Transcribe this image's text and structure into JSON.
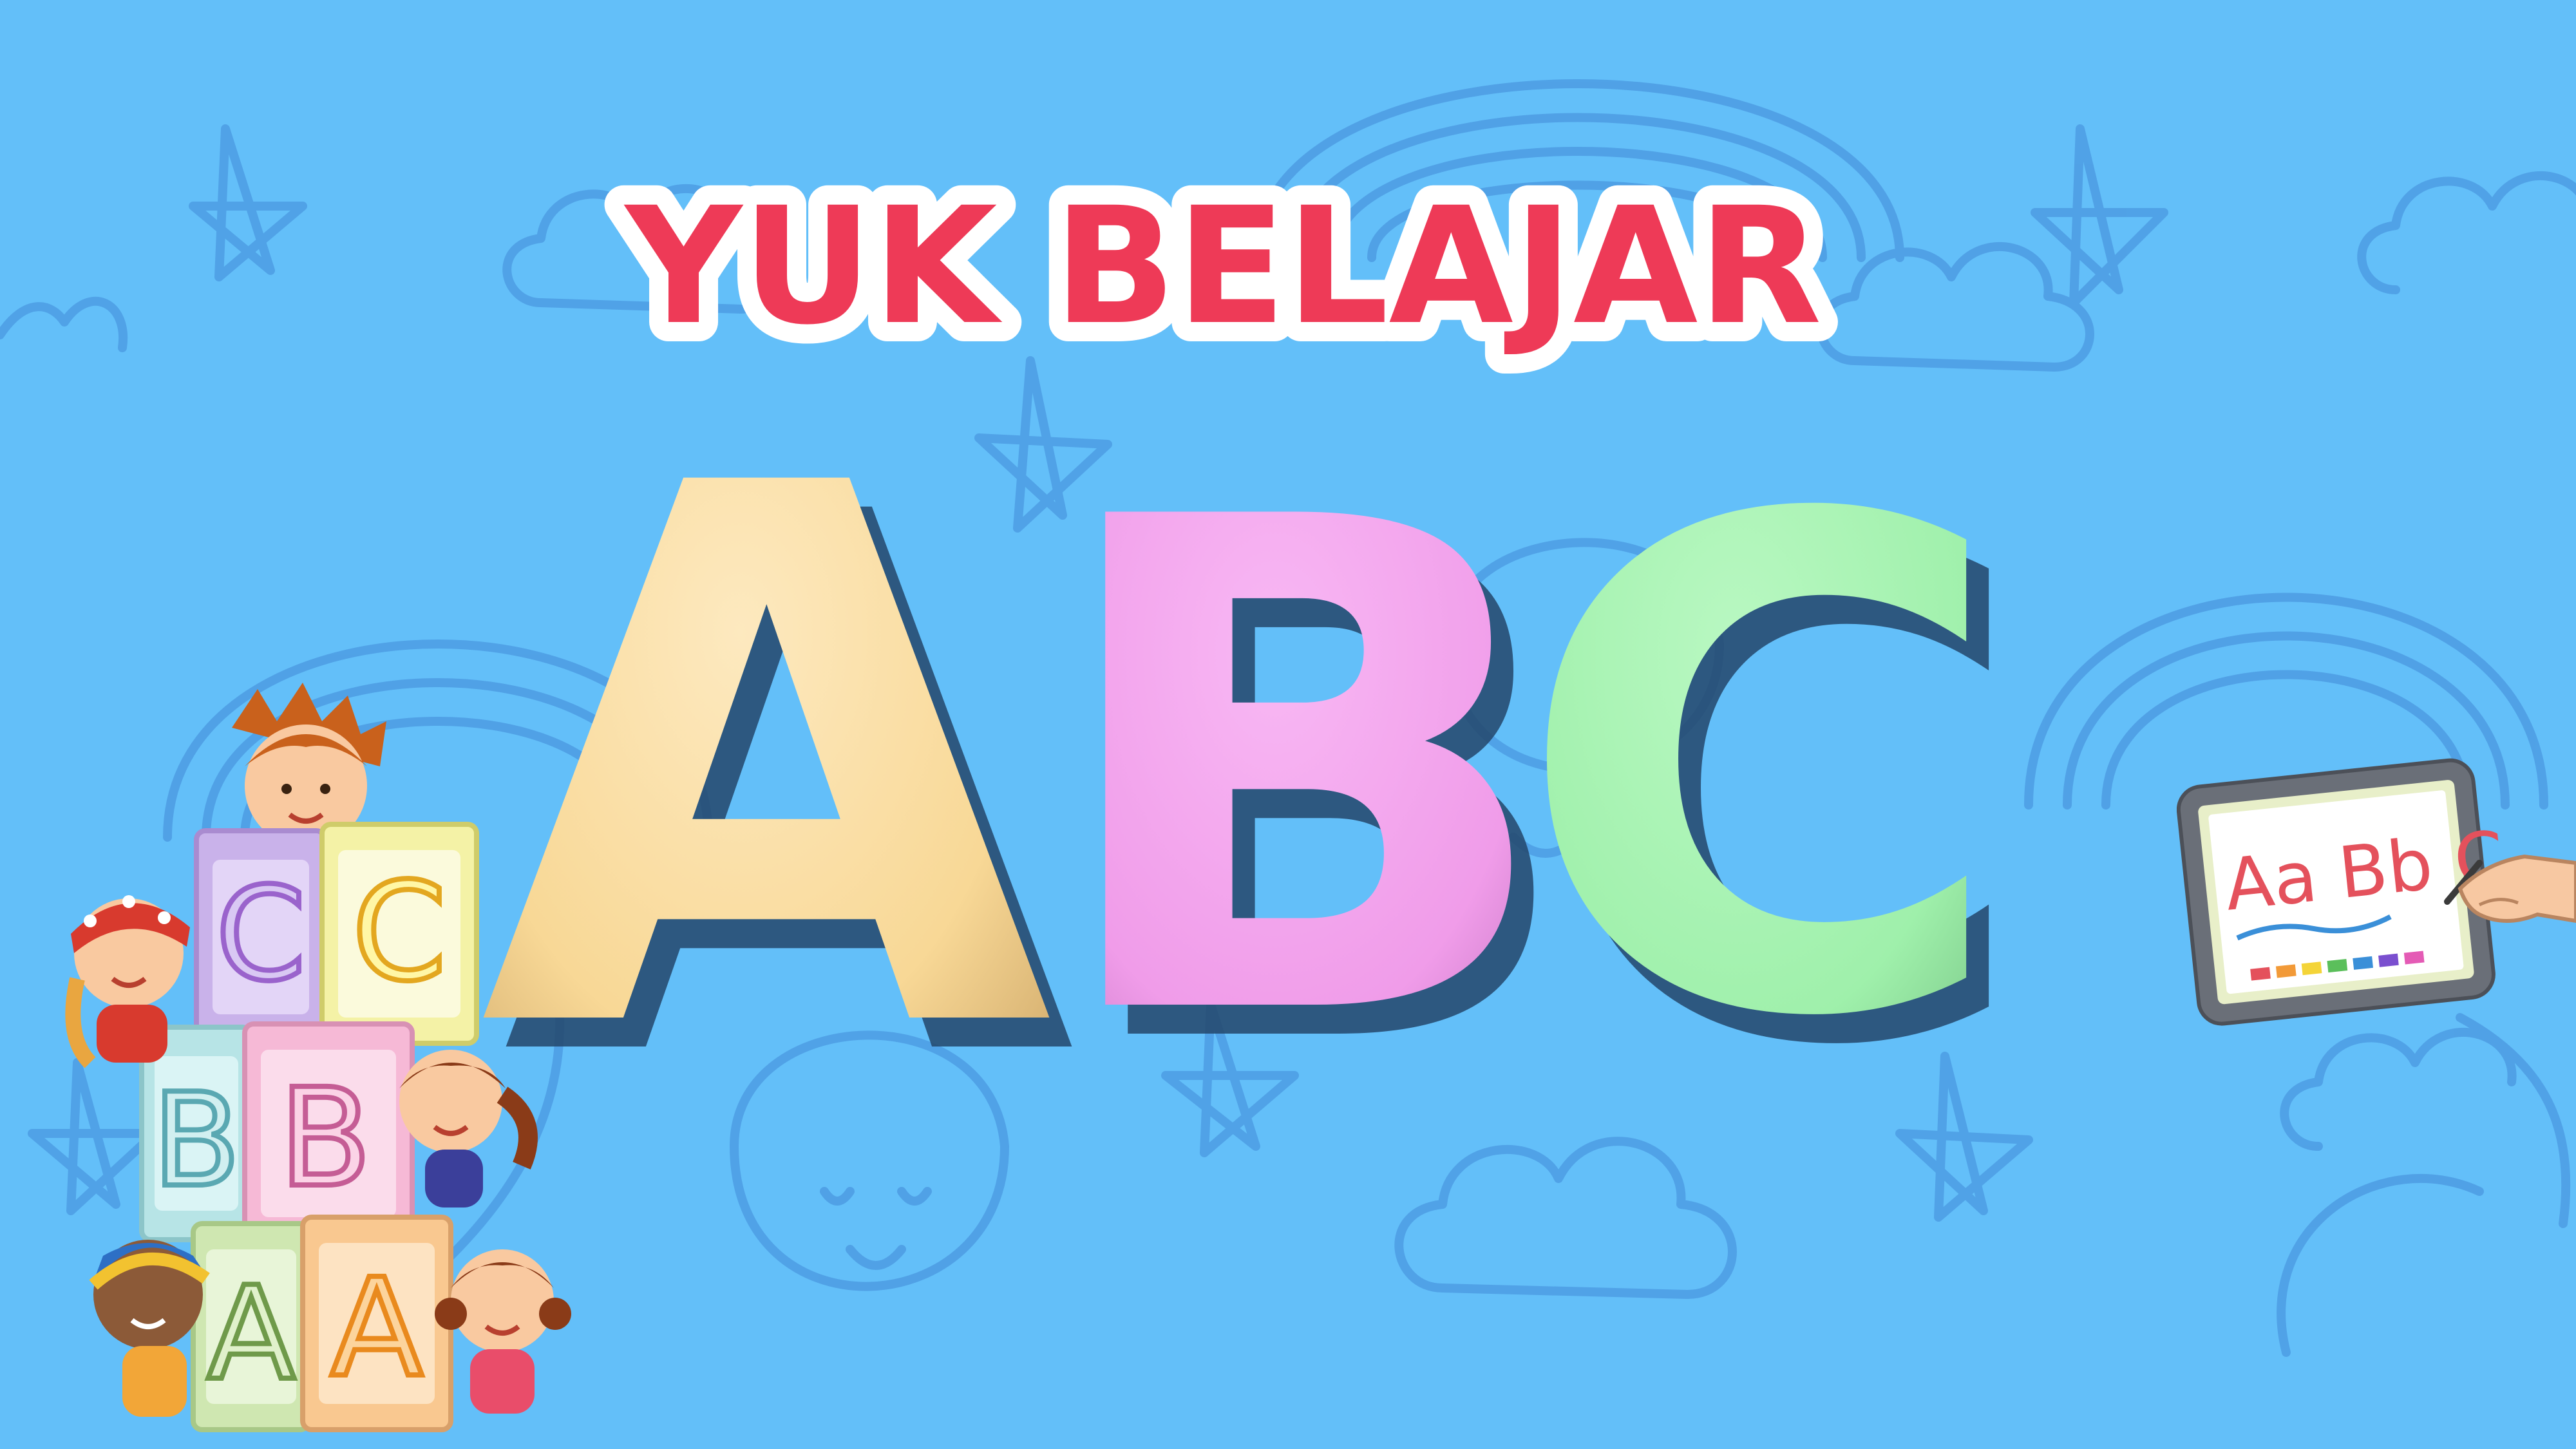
{
  "title": {
    "line1": "YUK BELAJAR"
  },
  "big_letters": [
    "A",
    "B",
    "C"
  ],
  "colors": {
    "background": "#63bff9",
    "doodle": "#4a98e0",
    "title_fill": "#ee3a57",
    "title_outline": "#ffffff",
    "letter_a": "#fbdfa2",
    "letter_b": "#f2a2ee",
    "letter_c": "#a6f3b1"
  },
  "blocks": {
    "top_left": "C",
    "top_right": "C",
    "middle_left": "B",
    "middle_right": "B",
    "bottom_left": "A",
    "bottom_right": "A"
  },
  "tablet": {
    "text": "Aa Bb C"
  },
  "icons": {
    "children": "children-icon",
    "blocks": "alphabet-blocks-icon",
    "tablet": "drawing-tablet-icon",
    "pattern": "doodle-pattern-icon"
  }
}
